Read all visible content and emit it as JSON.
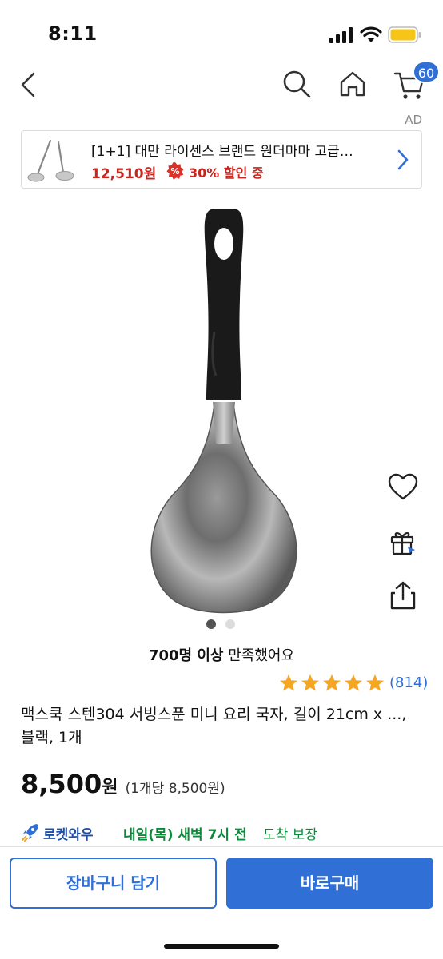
{
  "status_bar": {
    "time": "8:11",
    "icons": [
      "signal-icon",
      "wifi-icon",
      "battery-icon"
    ]
  },
  "nav": {
    "icons": [
      "back-icon",
      "search-icon",
      "home-icon",
      "cart-icon"
    ],
    "cart_badge": "60"
  },
  "ad": {
    "label": "AD",
    "title": "[1+1] 대만 라이센스 브랜드 원더마마 고급…",
    "price": "12,510원",
    "discount": "30% 할인 중",
    "thumbnail_icon": "ladle-set-thumbnail"
  },
  "side_actions": [
    "heart-icon",
    "gift-icon",
    "share-icon"
  ],
  "gallery": {
    "total": 2,
    "active": 1
  },
  "satisfaction": {
    "strong": "700명 이상",
    "text": " 만족했어요"
  },
  "rating": {
    "stars": 5,
    "review_count": "(814)"
  },
  "product": {
    "title": "맥스쿡 스텐304 서빙스푼 미니 요리 국자, 길이 21cm x ..., 블랙, 1개",
    "price": "8,500",
    "price_unit": "원",
    "unit_price": "(1개당 8,500원)"
  },
  "delivery": {
    "badge": "로켓와우",
    "date": "내일(목) 새벽 7시 전",
    "tail": "도착 보장"
  },
  "buttons": {
    "cart": "장바구니 담기",
    "buy": "바로구매"
  },
  "colors": {
    "accent": "#2f6fd6",
    "price_red": "#c8251f",
    "delivery_green": "#0a8a3a",
    "review_blue": "#2f6fd6",
    "star": "#f5a623"
  }
}
